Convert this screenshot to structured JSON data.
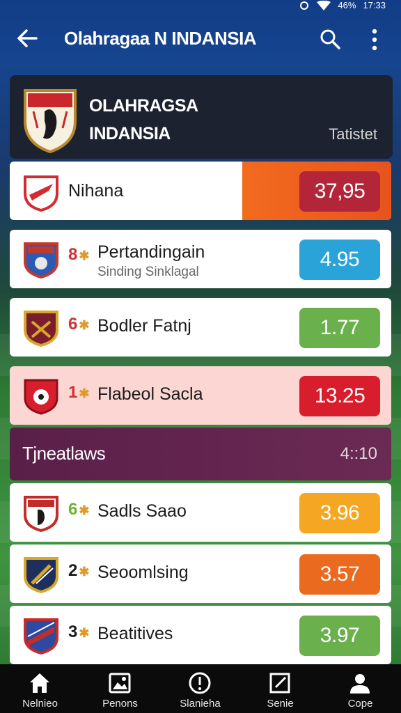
{
  "status": {
    "time": "17:33",
    "signal": "46%"
  },
  "app": {
    "title": "Olahragaa N INDANSIA"
  },
  "header": {
    "name_line1": "OLAHRAGSA",
    "name_line2": "INDANSIA",
    "tag": "Tatistet"
  },
  "rows": [
    {
      "rank": "",
      "label": "Nihana",
      "sub": "",
      "value": "37,95",
      "value_color": "#b3263a",
      "logo": "team-shield-red-icon"
    },
    {
      "rank": "8",
      "label": "Pertandingain",
      "sub": "Sinding Sinklagal",
      "value": "4.95",
      "value_color": "#2aa3d8",
      "logo": "team-crest-blue-icon"
    },
    {
      "rank": "6",
      "label": "Bodler Fatnj",
      "sub": "",
      "value": "1.77",
      "value_color": "#6ab04c",
      "logo": "team-crest-maroon-icon"
    },
    {
      "rank": "1",
      "label": "Flabeol Sacla",
      "sub": "",
      "value": "13.25",
      "value_color": "#d81e2c",
      "logo": "team-crest-ball-icon"
    }
  ],
  "section": {
    "title": "Tjneatlaws",
    "time": "4::10"
  },
  "rows2": [
    {
      "rank": "6",
      "label": "Sadls Saao",
      "value": "3.96",
      "value_color": "#f5a623",
      "logo": "team-crest-white-icon",
      "rank_color": "#6bb536"
    },
    {
      "rank": "2",
      "label": "Seoomlsing",
      "value": "3.57",
      "value_color": "#ea6a20",
      "logo": "team-crest-navy-icon",
      "rank_color": "#1b1b1b"
    },
    {
      "rank": "3",
      "label": "Beatitives",
      "value": "3.97",
      "value_color": "#6ab04c",
      "logo": "team-crest-redblue-icon",
      "rank_color": "#1b1b1b"
    }
  ],
  "nav": [
    {
      "label": "Nelnieo",
      "icon": "home-icon"
    },
    {
      "label": "Penons",
      "icon": "photo-icon"
    },
    {
      "label": "Slanieha",
      "icon": "alert-icon"
    },
    {
      "label": "Senie",
      "icon": "edit-icon"
    },
    {
      "label": "Cope",
      "icon": "person-icon"
    }
  ]
}
